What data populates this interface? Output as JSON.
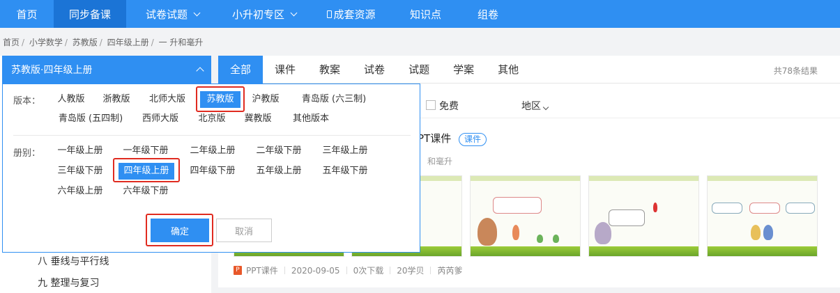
{
  "nav": {
    "items": [
      {
        "label": "首页"
      },
      {
        "label": "同步备课"
      },
      {
        "label": "试卷试题"
      },
      {
        "label": "小升初专区"
      },
      {
        "label": "成套资源"
      },
      {
        "label": "知识点"
      },
      {
        "label": "组卷"
      }
    ]
  },
  "breadcrumb": [
    "首页",
    "小学数学",
    "苏教版",
    "四年级上册",
    "一 升和毫升"
  ],
  "sidebar": {
    "edition_selected": "苏教版·四年级上册",
    "chapters": [
      "八 垂线与平行线",
      "九 整理与复习"
    ]
  },
  "dropdown": {
    "edition_label": "版本：",
    "editions": [
      "人教版",
      "浙教版",
      "北师大版",
      "苏教版",
      "沪教版",
      "青岛版 (六三制)",
      "青岛版 (五四制)",
      "西师大版",
      "北京版",
      "冀教版",
      "其他版本"
    ],
    "edition_selected": "苏教版",
    "grade_label": "册别：",
    "grades": [
      "一年级上册",
      "一年级下册",
      "二年级上册",
      "二年级下册",
      "三年级上册",
      "三年级下册",
      "四年级上册",
      "四年级下册",
      "五年级上册",
      "五年级下册",
      "六年级上册",
      "六年级下册"
    ],
    "grade_selected": "四年级上册",
    "confirm_label": "确定",
    "cancel_label": "取消"
  },
  "main": {
    "tabs": [
      "全部",
      "课件",
      "教案",
      "试卷",
      "试题",
      "学案",
      "其他"
    ],
    "active_tab": "全部",
    "result_count": "共78条结果",
    "filter_free": "免费",
    "filter_region": "地区",
    "item": {
      "title_tail": "PT课件",
      "badge": "课件",
      "subtitle_tail": "和毫升",
      "type": "PPT课件",
      "date": "2020-09-05",
      "downloads": "0次下载",
      "points": "20学贝",
      "author": "芮芮爹"
    }
  },
  "colors": {
    "accent": "#2f8ff2",
    "highlight_box": "#e02b20"
  }
}
